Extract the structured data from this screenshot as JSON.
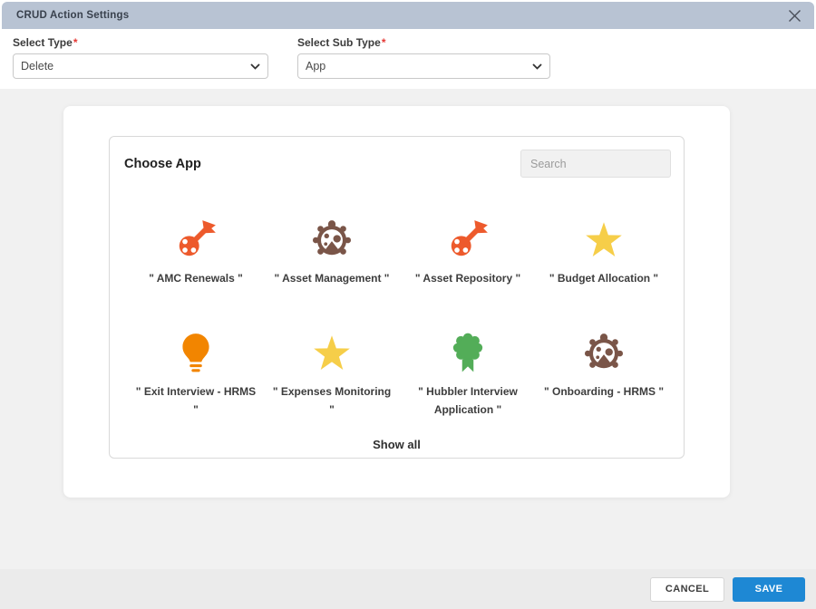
{
  "modal": {
    "title": "CRUD Action Settings"
  },
  "filters": {
    "type": {
      "label": "Select Type",
      "required_mark": "*",
      "value": "Delete"
    },
    "sub_type": {
      "label": "Select Sub Type",
      "required_mark": "*",
      "value": "App"
    }
  },
  "chooser": {
    "heading": "Choose App",
    "search_placeholder": "Search",
    "show_all_label": "Show all",
    "apps": [
      {
        "label": "\" AMC Renewals \"",
        "icon": "key-icon",
        "color": "#ed5a2c"
      },
      {
        "label": "\" Asset Management \"",
        "icon": "bug-icon",
        "color": "#7a5548"
      },
      {
        "label": "\" Asset Repository \"",
        "icon": "key-icon",
        "color": "#ed5a2c"
      },
      {
        "label": "\" Budget Allocation \"",
        "icon": "star-icon",
        "color": "#f6ce49"
      },
      {
        "label": "\" Exit Interview - HRMS \"",
        "icon": "lightbulb-icon",
        "color": "#f28500"
      },
      {
        "label": "\" Expenses Monitoring \"",
        "icon": "star-icon",
        "color": "#f6ce49"
      },
      {
        "label": "\" Hubbler Interview Application \"",
        "icon": "badge-icon",
        "color": "#53ad58"
      },
      {
        "label": "\" Onboarding - HRMS \"",
        "icon": "bug-icon",
        "color": "#7a5548"
      }
    ]
  },
  "footer": {
    "cancel_label": "CANCEL",
    "save_label": "SAVE"
  },
  "colors": {
    "header_bg": "#b8c3d3",
    "page_bg": "#f1f1f1",
    "footer_bg": "#ebebeb",
    "save_bg": "#1e88d4",
    "required_red": "#e53935",
    "border": "#d9d9d9"
  }
}
